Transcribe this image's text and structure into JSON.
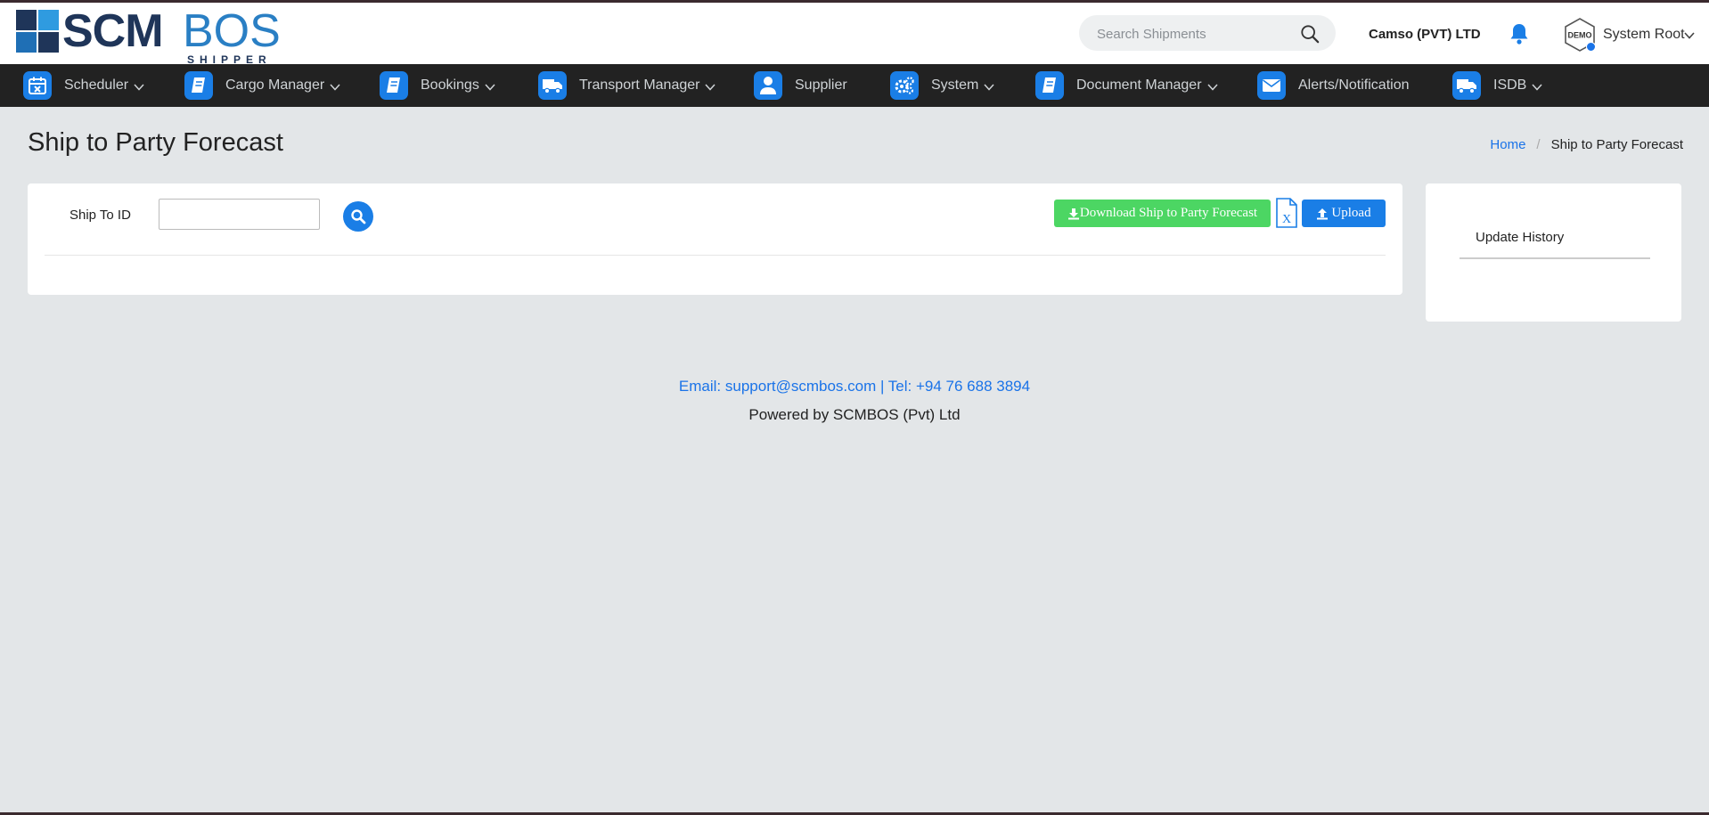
{
  "header": {
    "logo_text_main": "SCM",
    "logo_text_accent": "BOS",
    "logo_subtitle": "SHIPPER",
    "search_placeholder": "Search Shipments",
    "company_name": "Camso (PVT) LTD",
    "avatar_label": "DEMO",
    "user_name": "System Root"
  },
  "nav": {
    "items": [
      {
        "label": "Scheduler",
        "icon": "calendar-icon"
      },
      {
        "label": "Cargo Manager",
        "icon": "book-icon"
      },
      {
        "label": "Bookings",
        "icon": "book-icon"
      },
      {
        "label": "Transport Manager",
        "icon": "truck-icon"
      },
      {
        "label": "Supplier",
        "icon": "user-icon"
      },
      {
        "label": "System",
        "icon": "gears-icon"
      },
      {
        "label": "Document Manager",
        "icon": "book-icon"
      },
      {
        "label": "Alerts/Notification",
        "icon": "envelope-icon"
      },
      {
        "label": "ISDB",
        "icon": "truck-icon"
      }
    ]
  },
  "page": {
    "title": "Ship to Party Forecast",
    "breadcrumb_home": "Home",
    "breadcrumb_current": "Ship to Party Forecast"
  },
  "form": {
    "ship_to_label": "Ship To ID",
    "ship_to_value": "",
    "download_label": "Download Ship to Party Forecast",
    "upload_label": "Upload"
  },
  "side": {
    "title": "Update History"
  },
  "footer": {
    "contact": "Email: support@scmbos.com | Tel: +94 76 688 3894",
    "powered": "Powered by SCMBOS (Pvt) Ltd"
  },
  "colors": {
    "accent_blue": "#1a7ee6",
    "download_green": "#4cd663",
    "nav_bg": "#222222",
    "page_bg": "#e3e6e8"
  }
}
